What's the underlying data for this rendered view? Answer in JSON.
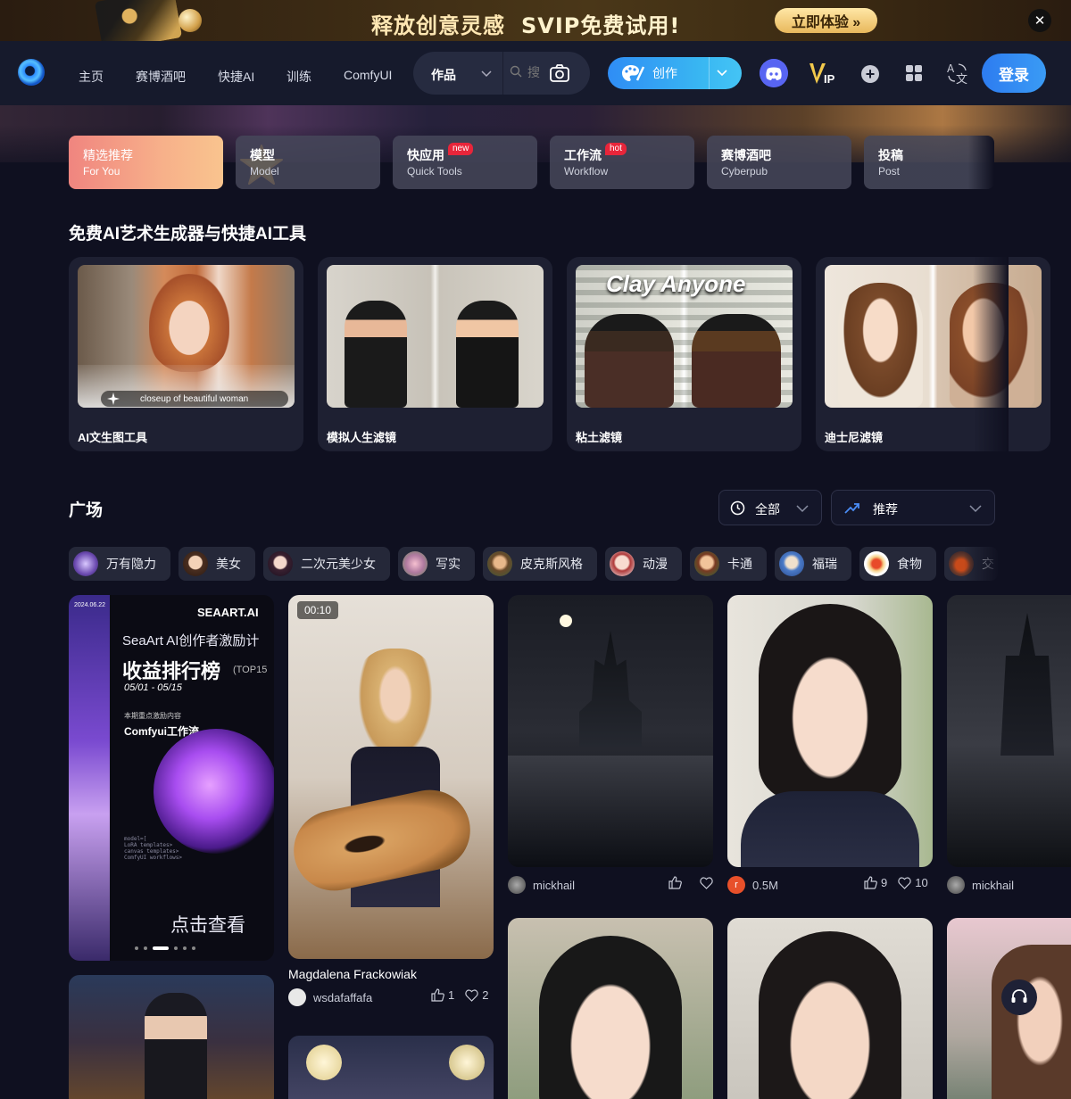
{
  "promo": {
    "text": "释放创意灵感",
    "svip": "SVIP免费试用!",
    "cta": "立即体验 »",
    "close": "✕"
  },
  "nav": {
    "links": [
      "主页",
      "赛博酒吧",
      "快捷AI",
      "训练",
      "ComfyUI"
    ],
    "search_type": "作品",
    "search_placeholder": "搜",
    "create": "创作",
    "vip": "IP",
    "login": "登录"
  },
  "categories": [
    {
      "title": "精选推荐",
      "sub": "For You"
    },
    {
      "title": "模型",
      "sub": "Model"
    },
    {
      "title": "快应用",
      "sub": "Quick Tools",
      "badge": "new"
    },
    {
      "title": "工作流",
      "sub": "Workflow",
      "badge": "hot"
    },
    {
      "title": "赛博酒吧",
      "sub": "Cyberpub"
    },
    {
      "title": "投稿",
      "sub": "Post"
    }
  ],
  "tools_section": {
    "title": "免费AI艺术生成器与快捷AI工具",
    "items": [
      {
        "label": "AI文生图工具",
        "caption": "closeup of beautiful woman"
      },
      {
        "label": "模拟人生滤镜"
      },
      {
        "label": "粘土滤镜",
        "caption": "Clay Anyone"
      },
      {
        "label": "迪士尼滤镜"
      }
    ]
  },
  "plaza": {
    "title": "广场",
    "filter_time": "全部",
    "filter_sort": "推荐",
    "chips": [
      "万有隐力",
      "美女",
      "二次元美少女",
      "写实",
      "皮克斯风格",
      "动漫",
      "卡通",
      "福瑞",
      "食物",
      "交"
    ]
  },
  "feed": {
    "banner": {
      "date": "2024.06.22",
      "brand": "SEAART.AI",
      "line1": "SeaArt AI创作者激励计",
      "line2": "收益排行榜",
      "top": "(TOP15",
      "range": "05/01 - 05/15",
      "note": "本期重点激励内容",
      "workflow": "Comfyui工作流",
      "code": "model=[\nLoRA templates>\ncanvas templates>\nComfyUI workflows>",
      "cta": "点击查看"
    },
    "video": {
      "duration": "00:10",
      "title": "Magdalena Frackowiak",
      "author": "wsdafaffafa",
      "likes": "1",
      "favs": "2"
    },
    "card3": {
      "author": "mickhail"
    },
    "card4": {
      "author": "0.5M",
      "avatar_letter": "r",
      "likes": "9",
      "favs": "10"
    },
    "card5": {
      "author": "mickhail"
    }
  },
  "colors": {
    "accent": "#2f8df5",
    "bg": "#0f1020",
    "nav": "#161a2c",
    "badge": "#e8253a"
  },
  "icons": [
    "logo-icon",
    "search-icon",
    "camera-icon",
    "palette-icon",
    "discord-icon",
    "vip-icon",
    "plus-icon",
    "apps-icon",
    "translate-icon",
    "clock-icon",
    "trend-icon",
    "like-icon",
    "heart-icon",
    "headset-icon",
    "close-icon",
    "chevron-down-icon"
  ]
}
